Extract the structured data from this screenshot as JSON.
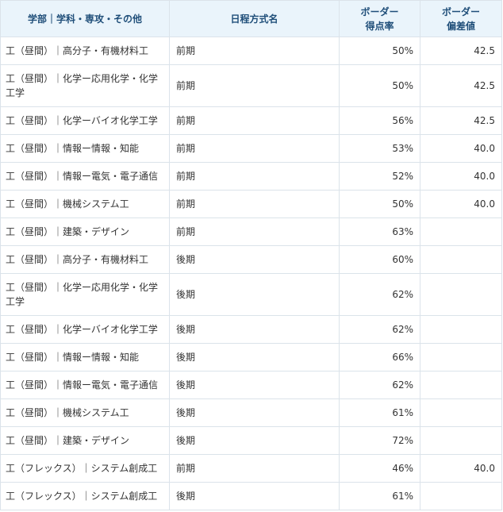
{
  "table": {
    "headers": {
      "faculty": "学部｜学科・専攻・その他",
      "schedule": "日程方式名",
      "border_rate_line1": "ボーダー",
      "border_rate_line2": "得点率",
      "border_dev_line1": "ボーダー",
      "border_dev_line2": "偏差値"
    },
    "rows": [
      {
        "faculty": "工（昼間）｜高分子・有機材料工",
        "schedule": "前期",
        "rate": "50%",
        "dev": "42.5"
      },
      {
        "faculty": "工（昼間）｜化学ー応用化学・化学工学",
        "schedule": "前期",
        "rate": "50%",
        "dev": "42.5"
      },
      {
        "faculty": "工（昼間）｜化学ーバイオ化学工学",
        "schedule": "前期",
        "rate": "56%",
        "dev": "42.5"
      },
      {
        "faculty": "工（昼間）｜情報ー情報・知能",
        "schedule": "前期",
        "rate": "53%",
        "dev": "40.0"
      },
      {
        "faculty": "工（昼間）｜情報ー電気・電子通信",
        "schedule": "前期",
        "rate": "52%",
        "dev": "40.0"
      },
      {
        "faculty": "工（昼間）｜機械システム工",
        "schedule": "前期",
        "rate": "50%",
        "dev": "40.0"
      },
      {
        "faculty": "工（昼間）｜建築・デザイン",
        "schedule": "前期",
        "rate": "63%",
        "dev": ""
      },
      {
        "faculty": "工（昼間）｜高分子・有機材料工",
        "schedule": "後期",
        "rate": "60%",
        "dev": ""
      },
      {
        "faculty": "工（昼間）｜化学ー応用化学・化学工学",
        "schedule": "後期",
        "rate": "62%",
        "dev": ""
      },
      {
        "faculty": "工（昼間）｜化学ーバイオ化学工学",
        "schedule": "後期",
        "rate": "62%",
        "dev": ""
      },
      {
        "faculty": "工（昼間）｜情報ー情報・知能",
        "schedule": "後期",
        "rate": "66%",
        "dev": ""
      },
      {
        "faculty": "工（昼間）｜情報ー電気・電子通信",
        "schedule": "後期",
        "rate": "62%",
        "dev": ""
      },
      {
        "faculty": "工（昼間）｜機械システム工",
        "schedule": "後期",
        "rate": "61%",
        "dev": ""
      },
      {
        "faculty": "工（昼間）｜建築・デザイン",
        "schedule": "後期",
        "rate": "72%",
        "dev": ""
      },
      {
        "faculty": "工（フレックス）｜システム創成工",
        "schedule": "前期",
        "rate": "46%",
        "dev": "40.0"
      },
      {
        "faculty": "工（フレックス）｜システム創成工",
        "schedule": "後期",
        "rate": "61%",
        "dev": ""
      }
    ]
  }
}
